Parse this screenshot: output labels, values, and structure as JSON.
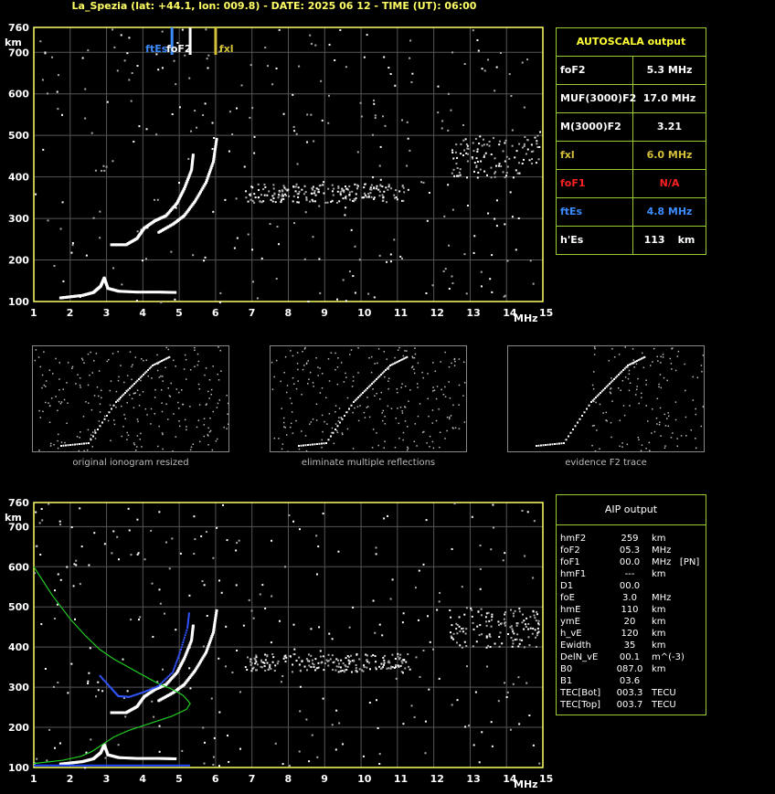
{
  "header": {
    "title": "La_Spezia (lat: +44.1, lon: 009.8) - DATE: 2025 06 12 - TIME (UT): 06:00"
  },
  "autoscala": {
    "title": "AUTOSCALA output",
    "rows": [
      {
        "label": "foF2",
        "value": "5.3 MHz",
        "color": "#ffffff"
      },
      {
        "label": "MUF(3000)F2",
        "value": "17.0 MHz",
        "color": "#ffffff"
      },
      {
        "label": "M(3000)F2",
        "value": "3.21",
        "color": "#ffffff"
      },
      {
        "label": "fxl",
        "value": "6.0 MHz",
        "color": "#d4c038"
      },
      {
        "label": "foF1",
        "value": "N/A",
        "color": "#ff2020"
      },
      {
        "label": "ftEs",
        "value": "4.8 MHz",
        "color": "#3a8cff"
      },
      {
        "label": "h'Es",
        "value": "113",
        "unit": "km",
        "color": "#ffffff"
      }
    ]
  },
  "aip": {
    "title": "AIP output",
    "rows": [
      {
        "k": "hmF2",
        "v": "259",
        "u": "km"
      },
      {
        "k": "foF2",
        "v": "05.3",
        "u": "MHz"
      },
      {
        "k": "foF1",
        "v": "00.0",
        "u": "MHz   [PN]"
      },
      {
        "k": "hmF1",
        "v": "---",
        "u": "km"
      },
      {
        "k": "D1",
        "v": "00.0",
        "u": ""
      },
      {
        "k": "foE",
        "v": "3.0",
        "u": "MHz"
      },
      {
        "k": "hmE",
        "v": "110",
        "u": "km"
      },
      {
        "k": "ymE",
        "v": "20",
        "u": "km"
      },
      {
        "k": "h_vE",
        "v": "120",
        "u": "km"
      },
      {
        "k": "Ewidth",
        "v": "35",
        "u": "km"
      },
      {
        "k": "DelN_vE",
        "v": "00.1",
        "u": "m^(-3)"
      },
      {
        "k": "B0",
        "v": "087.0",
        "u": "km"
      },
      {
        "k": "B1",
        "v": "03.6",
        "u": ""
      },
      {
        "k": "TEC[Bot]",
        "v": "003.3",
        "u": "TECU"
      },
      {
        "k": "TEC[Top]",
        "v": "003.7",
        "u": "TECU"
      }
    ]
  },
  "thumbs": [
    {
      "caption": "original ionogram resized"
    },
    {
      "caption": "eliminate multiple reflections"
    },
    {
      "caption": "evidence F2 trace"
    }
  ],
  "chart_data": [
    {
      "type": "scatter",
      "xlabel": "MHz",
      "ylabel": "km",
      "xlim": [
        1,
        15
      ],
      "ylim": [
        100,
        760
      ],
      "x_ticks": [
        1,
        2,
        3,
        4,
        5,
        6,
        7,
        8,
        9,
        10,
        11,
        12,
        13,
        14,
        15
      ],
      "y_ticks": [
        100,
        200,
        300,
        400,
        500,
        600,
        700,
        760
      ],
      "grid": true,
      "markers": [
        {
          "name": "ftEs",
          "x": 4.8,
          "color": "#3a8cff"
        },
        {
          "name": "foF2",
          "x": 5.3,
          "color": "#ffffff"
        },
        {
          "name": "fxl",
          "x": 6.0,
          "color": "#d4c038"
        }
      ],
      "traces": [
        {
          "name": "E/Es",
          "points": [
            [
              1.7,
              112
            ],
            [
              2.0,
              115
            ],
            [
              2.3,
              118
            ],
            [
              2.6,
              125
            ],
            [
              2.8,
              140
            ],
            [
              2.9,
              160
            ],
            [
              3.0,
              135
            ],
            [
              3.3,
              128
            ],
            [
              3.8,
              126
            ],
            [
              4.4,
              126
            ],
            [
              4.9,
              125
            ]
          ]
        },
        {
          "name": "F-o",
          "points": [
            [
              3.1,
              240
            ],
            [
              3.5,
              240
            ],
            [
              3.8,
              255
            ],
            [
              4.0,
              280
            ],
            [
              4.3,
              298
            ],
            [
              4.6,
              310
            ],
            [
              4.9,
              340
            ],
            [
              5.1,
              375
            ],
            [
              5.3,
              420
            ],
            [
              5.35,
              460
            ]
          ]
        },
        {
          "name": "F-x",
          "points": [
            [
              4.4,
              270
            ],
            [
              4.8,
              290
            ],
            [
              5.1,
              310
            ],
            [
              5.4,
              345
            ],
            [
              5.7,
              390
            ],
            [
              5.9,
              440
            ],
            [
              6.0,
              500
            ]
          ]
        }
      ]
    },
    {
      "type": "scatter",
      "xlabel": "MHz",
      "ylabel": "km",
      "xlim": [
        1,
        15
      ],
      "ylim": [
        100,
        760
      ],
      "x_ticks": [
        1,
        2,
        3,
        4,
        5,
        6,
        7,
        8,
        9,
        10,
        11,
        12,
        13,
        14,
        15
      ],
      "y_ticks": [
        100,
        200,
        300,
        400,
        500,
        600,
        700,
        760
      ],
      "grid": true,
      "profile": [
        [
          1.0,
          600
        ],
        [
          1.5,
          530
        ],
        [
          2.0,
          470
        ],
        [
          2.4,
          430
        ],
        [
          2.8,
          395
        ],
        [
          3.2,
          370
        ],
        [
          3.6,
          350
        ],
        [
          4.0,
          330
        ],
        [
          4.4,
          310
        ],
        [
          4.8,
          295
        ],
        [
          5.1,
          280
        ],
        [
          5.25,
          265
        ],
        [
          5.3,
          259
        ],
        [
          5.2,
          245
        ],
        [
          4.8,
          228
        ],
        [
          4.2,
          210
        ],
        [
          3.6,
          192
        ],
        [
          3.2,
          176
        ],
        [
          2.9,
          158
        ],
        [
          2.6,
          140
        ],
        [
          2.3,
          128
        ],
        [
          1.8,
          118
        ],
        [
          1.0,
          110
        ]
      ],
      "synthetic": [
        [
          2.8,
          330
        ],
        [
          3.1,
          300
        ],
        [
          3.3,
          280
        ],
        [
          3.6,
          278
        ],
        [
          4.0,
          290
        ],
        [
          4.4,
          305
        ],
        [
          4.8,
          340
        ],
        [
          5.0,
          390
        ],
        [
          5.2,
          450
        ],
        [
          5.25,
          490
        ]
      ]
    }
  ]
}
